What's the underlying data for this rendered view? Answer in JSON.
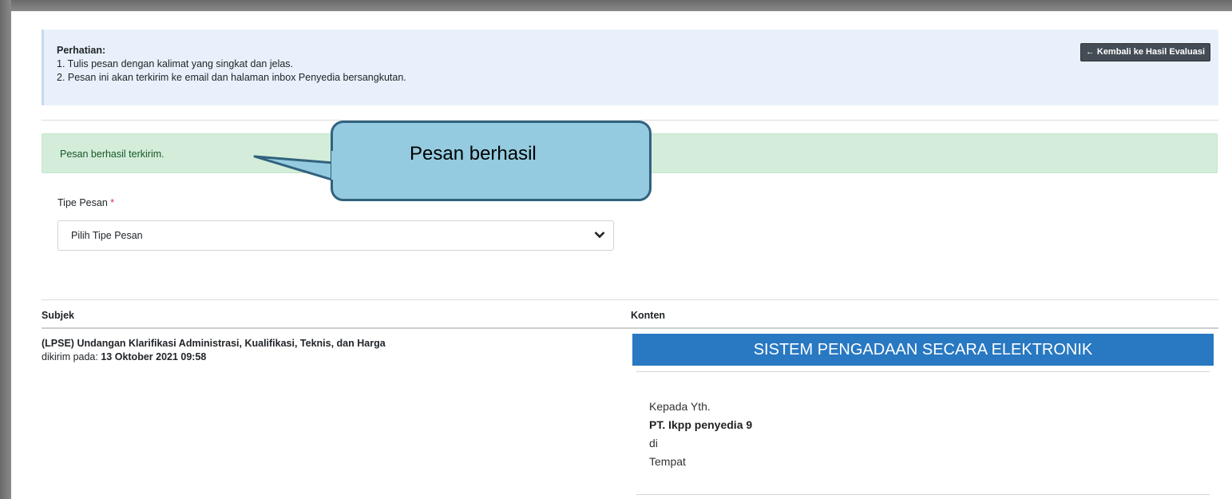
{
  "notice": {
    "title": "Perhatian:",
    "line1": "1. Tulis pesan dengan kalimat yang singkat dan jelas.",
    "line2": "2. Pesan ini akan terkirim ke email dan halaman inbox Penyedia bersangkutan.",
    "back_button": "← Kembali ke Hasil Evaluasi"
  },
  "alert": {
    "message": "Pesan berhasil terkirim."
  },
  "callout": {
    "text": "Pesan berhasil"
  },
  "form": {
    "type_label": "Tipe Pesan",
    "required_mark": "*",
    "type_select_value": "Pilih Tipe Pesan",
    "chevron_icon": "chevron-down-icon"
  },
  "table": {
    "headers": [
      "Subjek",
      "Konten"
    ],
    "rows": [
      {
        "subject": "(LPSE) Undangan Klarifikasi Administrasi, Kualifikasi, Teknis, dan Harga",
        "sent_label": "dikirim pada: ",
        "sent_at": "13 Oktober 2021 09:58",
        "content": {
          "header": "SISTEM PENGADAAN SECARA ELEKTRONIK",
          "to_line": "Kepada Yth.",
          "recipient": "PT. Ikpp penyedia 9",
          "di": "di",
          "place": "Tempat"
        }
      }
    ]
  },
  "colors": {
    "notice_bg": "#e8f1fb",
    "success_bg": "#d4edda",
    "success_text": "#155724",
    "callout_fill": "#94cbe0",
    "callout_border": "#31627e",
    "email_header": "#2878c2"
  }
}
